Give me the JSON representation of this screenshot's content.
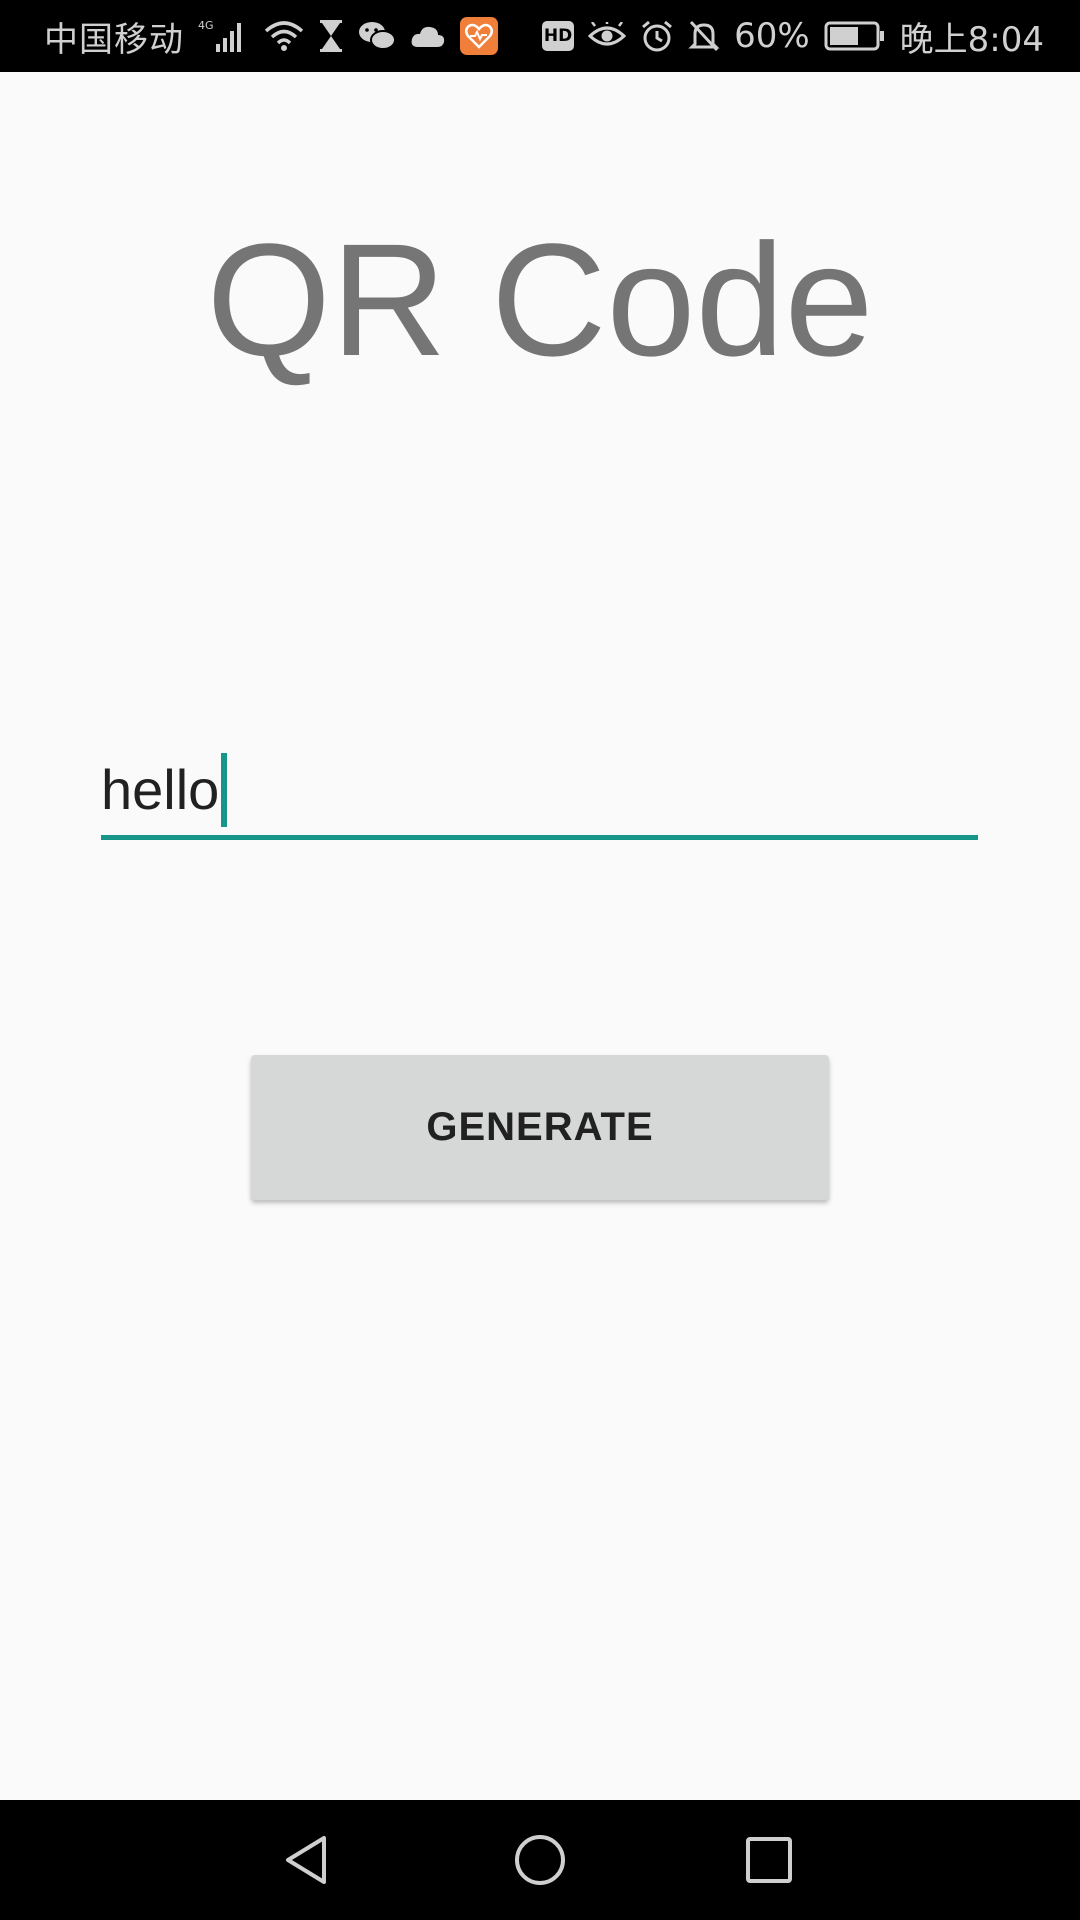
{
  "status_bar": {
    "carrier": "中国移动",
    "network": "4G",
    "battery_percent": "60%",
    "time": "晚上8:04",
    "hd_label": "HD",
    "icons": [
      "signal-icon",
      "wifi-icon",
      "hourglass-icon",
      "wechat-icon",
      "cloud-icon",
      "health-app-icon",
      "hd-icon",
      "eye-icon",
      "alarm-icon",
      "mute-icon",
      "battery-icon"
    ]
  },
  "main": {
    "title": "QR Code",
    "input_value": "hello",
    "button_label": "GENERATE"
  },
  "colors": {
    "accent": "#169688",
    "title_text": "#757575",
    "button_bg": "#d6d7d7",
    "background": "#fafafa"
  },
  "nav_bar": {
    "icons": [
      "back-icon",
      "home-icon",
      "recents-icon"
    ]
  }
}
